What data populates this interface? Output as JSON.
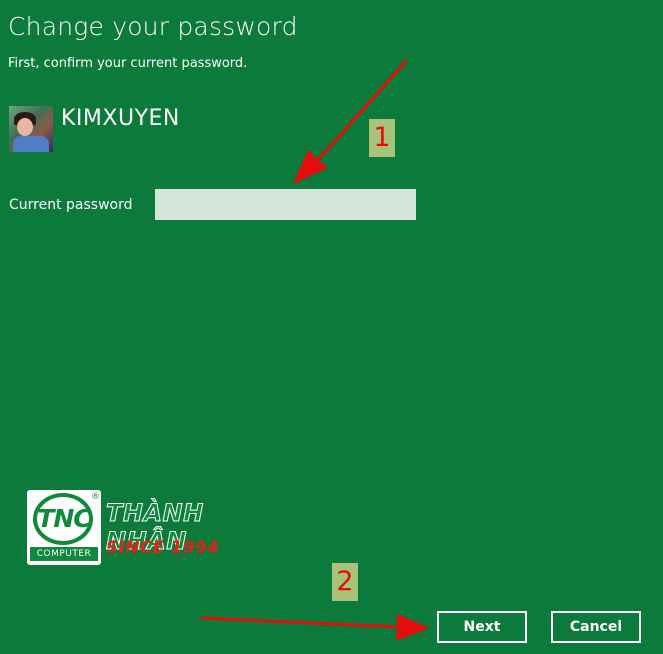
{
  "dialog": {
    "title": "Change your password",
    "subtitle": "First, confirm your current password."
  },
  "user": {
    "name": "KIMXUYEN",
    "avatar_icon": "user-photo"
  },
  "form": {
    "current_password_label": "Current password",
    "current_password_value": ""
  },
  "buttons": {
    "next_label": "Next",
    "cancel_label": "Cancel"
  },
  "annotations": {
    "step_1": "1",
    "step_2": "2",
    "arrow_color": "#e20d0d",
    "badge_color": "#a8c27a"
  },
  "watermark": {
    "badge_text": "TNC",
    "badge_sub": "COMPUTER",
    "registered": "®",
    "name": "THÀNH NHÂN",
    "since": "SINCE 1994"
  },
  "colors": {
    "background": "#0c7a3a",
    "input_background": "#d3e6db",
    "text": "#ffffff"
  }
}
